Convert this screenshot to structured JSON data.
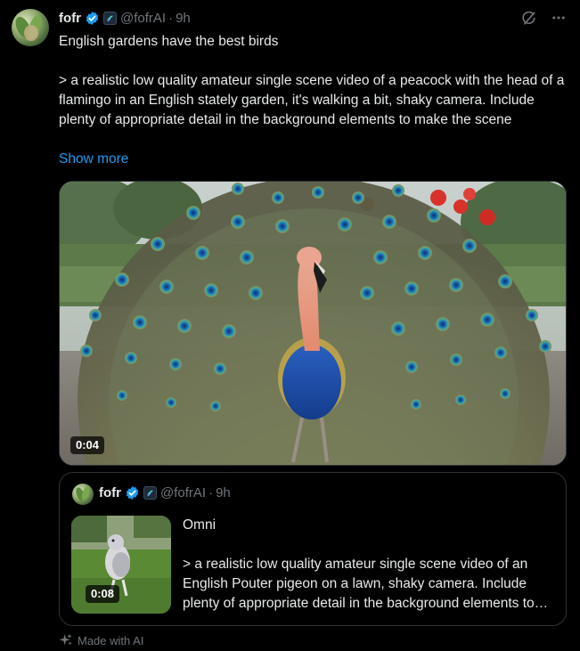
{
  "tweet": {
    "author_name": "fofr",
    "handle": "@fofrAI",
    "separator": "·",
    "time": "9h",
    "text": "English gardens have the best birds\n\n> a realistic low quality amateur single scene video of a peacock with the head of a flamingo in an English stately garden, it's walking a bit, shaky camera. Include plenty of appropriate detail in the background elements to make the scene",
    "show_more_label": "Show more",
    "video_duration": "0:04"
  },
  "quote": {
    "author_name": "fofr",
    "handle": "@fofrAI",
    "separator": "·",
    "time": "9h",
    "title": "Omni",
    "text": "> a realistic low quality amateur single scene video of an English Pouter pigeon on a lawn, shaky camera. Include plenty of appropriate detail in the background elements to make the scene",
    "video_duration": "0:08"
  },
  "footer": {
    "made_with_ai_label": "Made with AI"
  },
  "icons": {
    "verified": "verified-badge-icon",
    "affiliate": "affiliate-badge-icon",
    "grok": "grok-icon",
    "more": "more-icon",
    "sparkle": "sparkle-icon"
  },
  "colors": {
    "background": "#000000",
    "text": "#e7e9ea",
    "muted": "#71767b",
    "link": "#1d9bf0",
    "border": "#2f3336",
    "verified": "#1d9bf0"
  }
}
